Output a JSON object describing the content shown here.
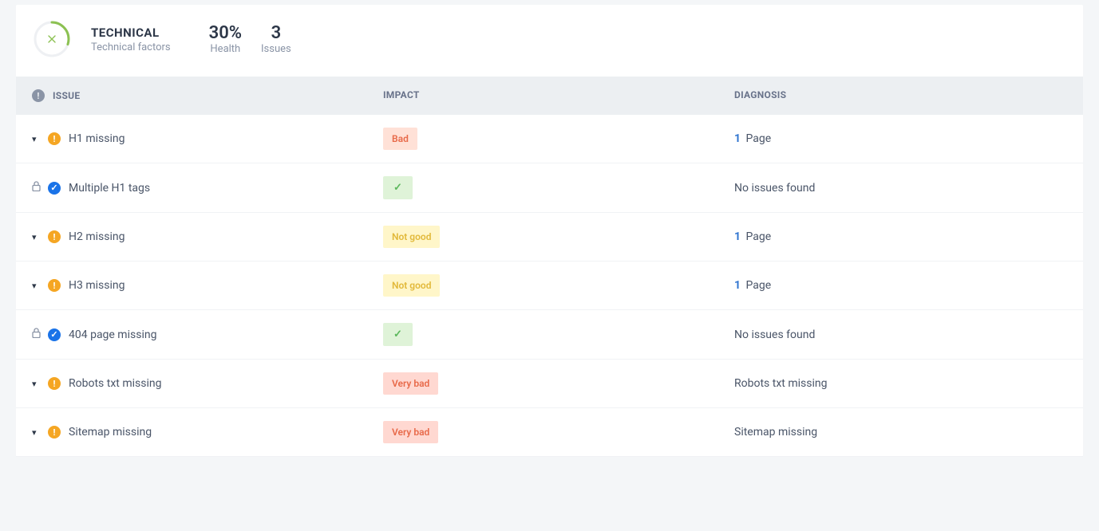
{
  "header": {
    "title": "TECHNICAL",
    "subtitle": "Technical factors",
    "metrics": [
      {
        "value": "30%",
        "label": "Health"
      },
      {
        "value": "3",
        "label": "Issues"
      }
    ]
  },
  "columns": {
    "issue": "ISSUE",
    "impact": "IMPACT",
    "diagnosis": "DIAGNOSIS"
  },
  "impact_labels": {
    "bad": "Bad",
    "not_good": "Not good",
    "very_bad": "Very bad"
  },
  "rows": [
    {
      "expandable": true,
      "status": "warn",
      "name": "H1 missing",
      "impact": "bad",
      "diag_count": "1",
      "diag_text": "Page"
    },
    {
      "expandable": false,
      "status": "ok",
      "name": "Multiple H1 tags",
      "impact": "ok",
      "diag_text": "No issues found"
    },
    {
      "expandable": true,
      "status": "warn",
      "name": "H2 missing",
      "impact": "not_good",
      "diag_count": "1",
      "diag_text": "Page"
    },
    {
      "expandable": true,
      "status": "warn",
      "name": "H3 missing",
      "impact": "not_good",
      "diag_count": "1",
      "diag_text": "Page"
    },
    {
      "expandable": false,
      "status": "ok",
      "name": "404 page missing",
      "impact": "ok",
      "diag_text": "No issues found"
    },
    {
      "expandable": true,
      "status": "warn",
      "name": "Robots txt missing",
      "impact": "very_bad",
      "diag_text": "Robots txt missing"
    },
    {
      "expandable": true,
      "status": "warn",
      "name": "Sitemap missing",
      "impact": "very_bad",
      "diag_text": "Sitemap missing"
    }
  ]
}
